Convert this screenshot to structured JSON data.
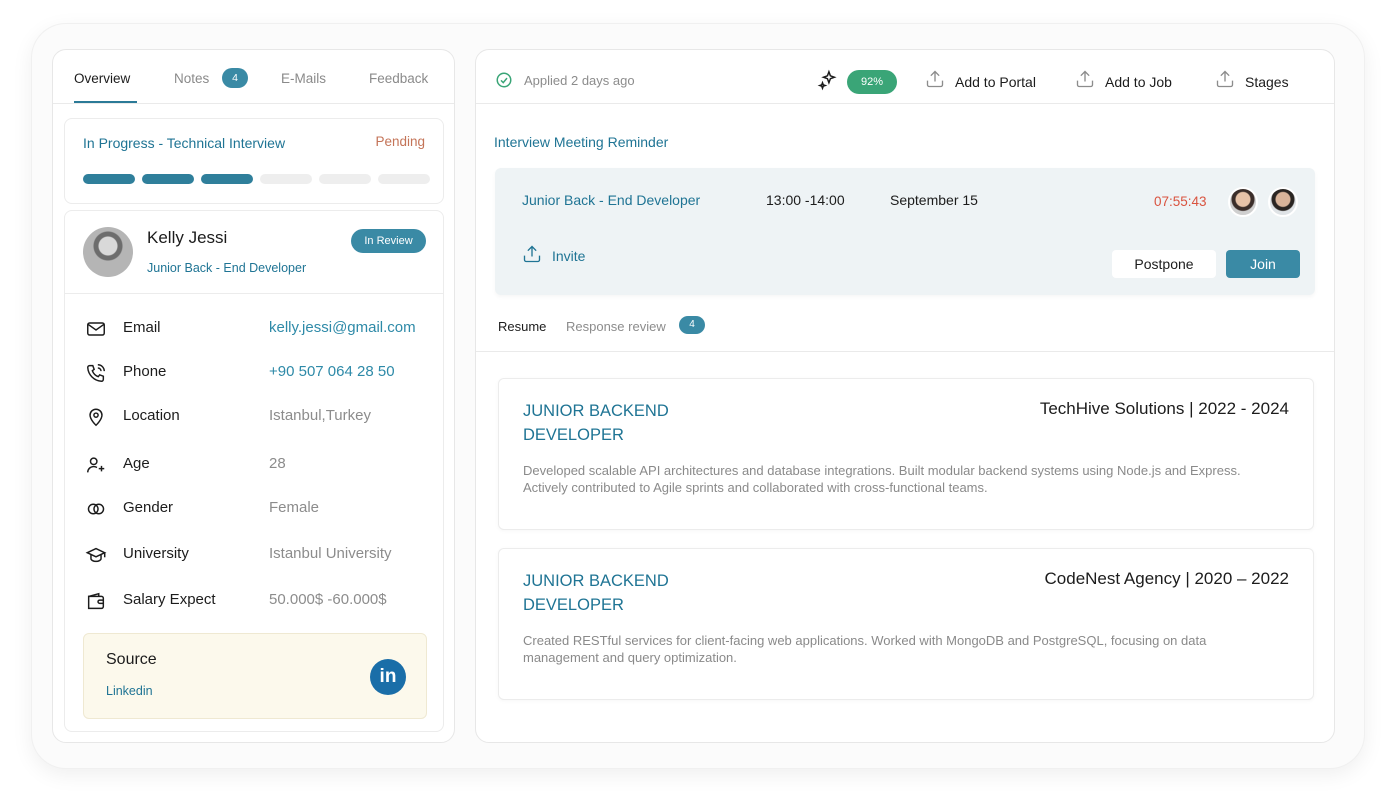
{
  "left_panel": {
    "tabs": [
      {
        "label": "Overview"
      },
      {
        "label": "Notes",
        "badge": "4"
      },
      {
        "label": "E-Mails"
      },
      {
        "label": "Feedback"
      }
    ],
    "progress": {
      "title": "In Progress - Technical Interview",
      "status": "Pending",
      "segments_filled": 3,
      "segments_total": 6
    },
    "profile": {
      "name": "Kelly Jessi",
      "role": "Junior Back - End Developer",
      "status": "In Review"
    },
    "info": [
      {
        "icon": "mail-icon",
        "label": "Email",
        "value": "kelly.jessi@gmail.com"
      },
      {
        "icon": "phone-icon",
        "label": "Phone",
        "value": "+90 507 064 28 50"
      },
      {
        "icon": "location-pin-icon",
        "label": "Location",
        "value": "Istanbul,Turkey"
      },
      {
        "icon": "user-plus-icon",
        "label": "Age",
        "value": "28"
      },
      {
        "icon": "gender-icon",
        "label": "Gender",
        "value": "Female"
      },
      {
        "icon": "graduation-cap-icon",
        "label": "University",
        "value": "Istanbul University"
      },
      {
        "icon": "wallet-icon",
        "label": "Salary Expect",
        "value": "50.000$ -60.000$"
      }
    ],
    "source": {
      "title": "Source",
      "value": "Linkedin",
      "logo_text": "in"
    }
  },
  "right_panel": {
    "header": {
      "applied": "Applied 2 days ago",
      "score": "92%",
      "actions": [
        {
          "icon": "upload-icon",
          "label": "Add to Portal"
        },
        {
          "icon": "upload-icon",
          "label": "Add to Job"
        },
        {
          "icon": "upload-icon",
          "label": "Stages"
        }
      ]
    },
    "reminder": {
      "title": "Interview Meeting Reminder",
      "role": "Junior Back - End Developer",
      "time": "13:00 -14:00",
      "date": "September 15",
      "countdown": "07:55:43",
      "invite_label": "Invite",
      "postpone_label": "Postpone",
      "join_label": "Join"
    },
    "sub_tabs": [
      {
        "label": "Resume"
      },
      {
        "label": "Response review",
        "badge": "4"
      }
    ],
    "experience": [
      {
        "title": "JUNIOR BACKEND DEVELOPER",
        "company": "TechHive Solutions | 2022 - 2024",
        "description": "Developed scalable API architectures and database integrations. Built modular backend systems using Node.js and Express. Actively contributed to Agile sprints and collaborated with cross-functional teams."
      },
      {
        "title": "JUNIOR BACKEND DEVELOPER",
        "company": "CodeNest Agency | 2020 – 2022",
        "description": "Created RESTful services for client-facing web applications. Worked with MongoDB and PostgreSQL, focusing on data management and query optimization."
      }
    ]
  },
  "colors": {
    "accent": "#3a8aa5",
    "accent_text": "#1f7494",
    "pending": "#c47458",
    "countdown": "#d9533f",
    "score": "#3aa577",
    "source_bg": "#fcf9ec",
    "linkedin": "#1a6ea8"
  }
}
